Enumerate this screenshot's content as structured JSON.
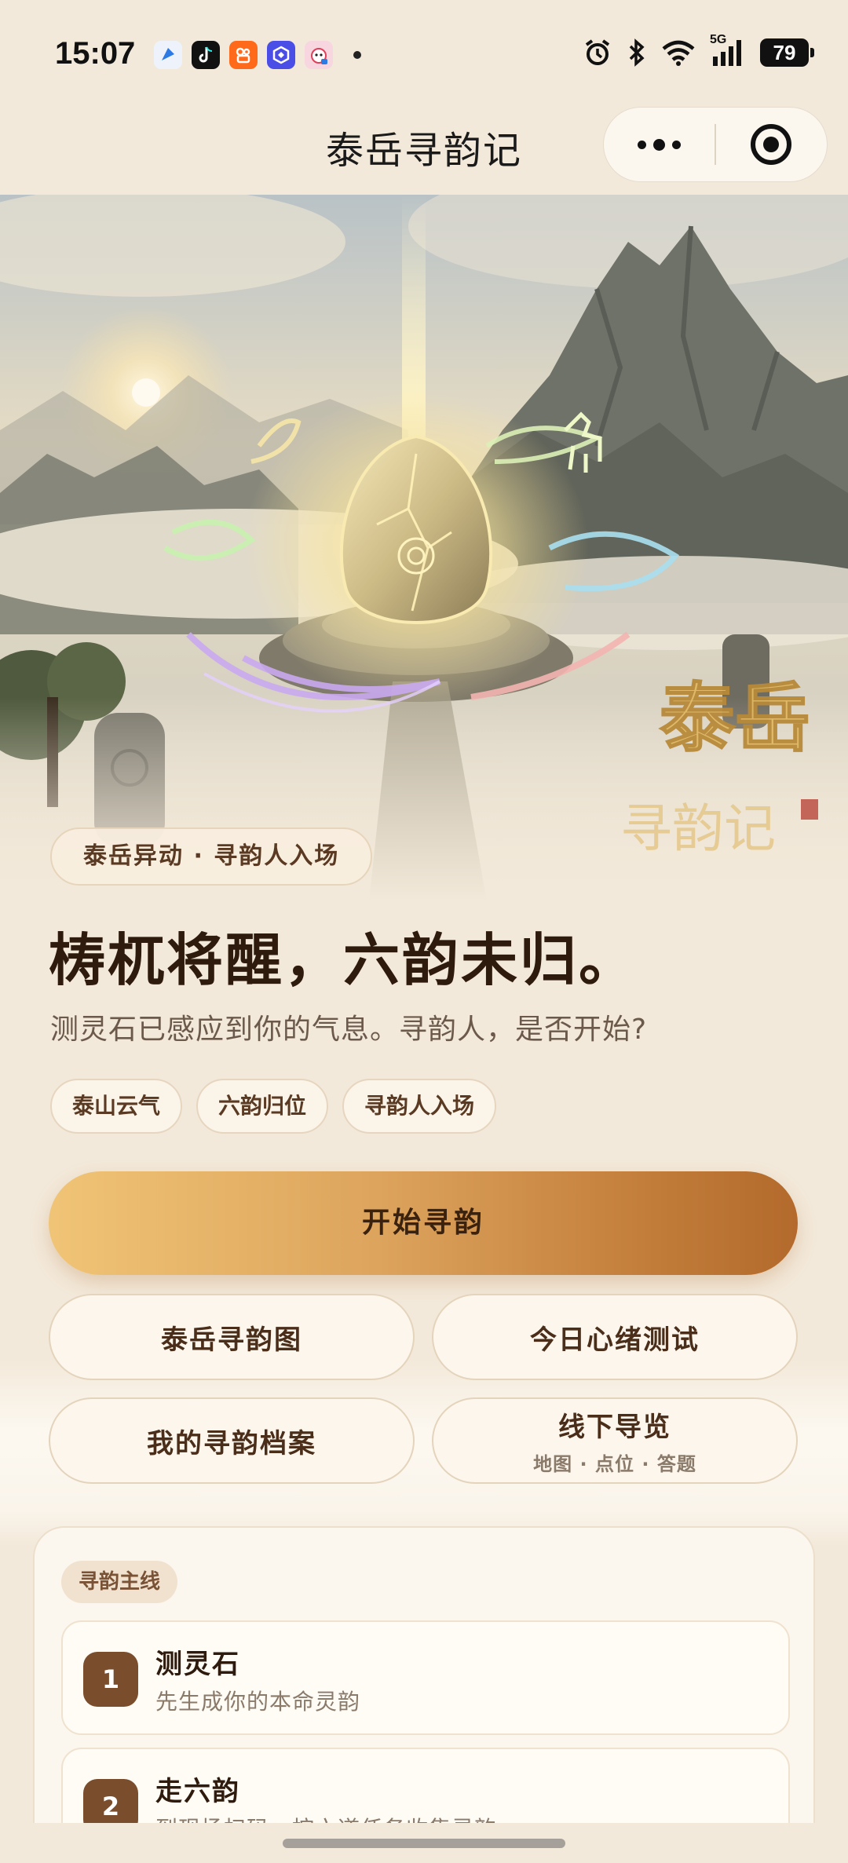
{
  "status_bar": {
    "time": "15:07",
    "battery": "79",
    "network": "5G",
    "notification_icons": [
      "message-app-icon",
      "tiktok-icon",
      "kuaishou-icon",
      "shield-app-icon",
      "tiger-app-icon"
    ],
    "system_icons": [
      "alarm-icon",
      "bluetooth-icon",
      "wifi-icon",
      "signal-icon",
      "battery-icon"
    ]
  },
  "nav": {
    "title": "泰岳寻韵记"
  },
  "hero": {
    "logo_text": "泰岳",
    "logo_sub": "寻韵记",
    "tag": "泰岳异动 · 寻韵人入场",
    "headline": "梼杌将醒，六韵未归。",
    "subline": "测灵石已感应到你的气息。寻韵人，是否开始?"
  },
  "chips": [
    "泰山云气",
    "六韵归位",
    "寻韵人入场"
  ],
  "actions": {
    "start": "开始寻韵",
    "map": "泰岳寻韵图",
    "mood_test": "今日心绪测试",
    "archive": "我的寻韵档案",
    "tour": "线下导览",
    "tour_sub": "地图 · 点位 · 答题"
  },
  "mainline": {
    "tag": "寻韵主线",
    "steps": [
      {
        "num": "1",
        "title": "测灵石",
        "desc": "先生成你的本命灵韵"
      },
      {
        "num": "2",
        "title": "走六韵",
        "desc": "到现场扫码，按六道任务收集灵韵"
      }
    ]
  },
  "colors": {
    "background": "#f3e9da",
    "accent_gold": "#dca35c",
    "accent_brown": "#7a4e2c",
    "text_dark": "#2e1b0e"
  }
}
